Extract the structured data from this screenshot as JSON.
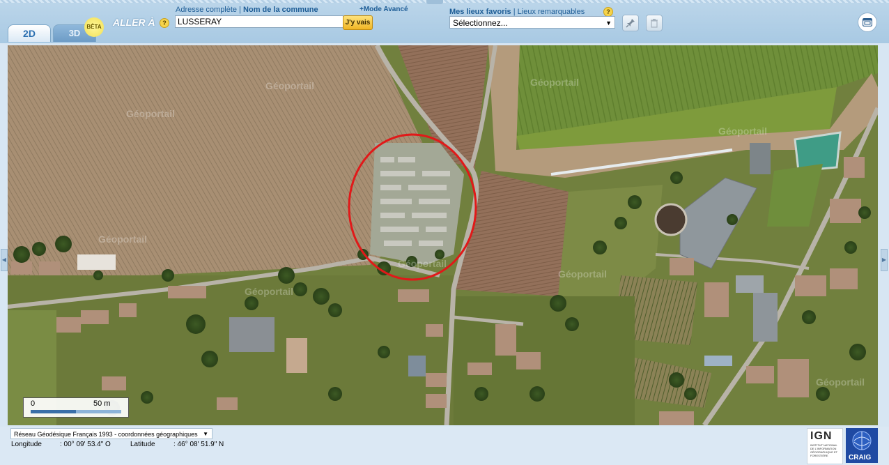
{
  "tabs": [
    {
      "label": "2D",
      "active": true
    },
    {
      "label": "3D",
      "active": false
    }
  ],
  "beta_label": "BÊTA",
  "goto": {
    "label": "ALLER À",
    "help": "?",
    "field_labels": {
      "full_address": "Adresse complète",
      "separator": " | ",
      "commune": "Nom de la commune"
    },
    "advanced_label": "+Mode Avancé",
    "input_value": "LUSSERAY",
    "go_button": "J'y vais"
  },
  "favorites": {
    "label_fav": "Mes lieux favoris",
    "separator": " | ",
    "label_remarkable": "Lieux remarquables",
    "help": "?",
    "select_value": "Sélectionnez..."
  },
  "icons": [
    "pin-icon",
    "trash-icon",
    "window-icon"
  ],
  "map": {
    "watermark": "Géoportail",
    "scale": {
      "left": "0",
      "right": "50 m"
    }
  },
  "footer": {
    "projection": "Réseau Géodésique Français 1993 - coordonnées géographiques",
    "longitude_label": "Longitude",
    "longitude_value": ": 00° 09' 53.4\" O",
    "latitude_label": "Latitude",
    "latitude_value": ": 46° 08' 51.9\" N"
  },
  "logos": {
    "ign": "IGN",
    "ign_sub": "INSTITUT NATIONAL DE L'INFORMATION GÉOGRAPHIQUE ET FORESTIÈRE",
    "craig": "CRAIG"
  },
  "colors": {
    "highlight_circle": "#e11919",
    "accent_blue": "#1e5d96",
    "go_button": "#f0b525"
  }
}
